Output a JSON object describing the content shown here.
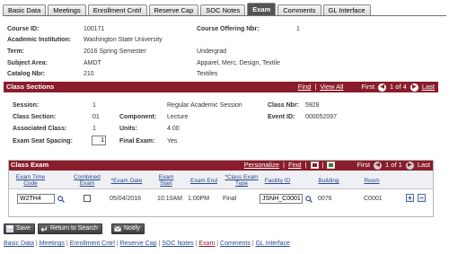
{
  "tabs": [
    {
      "label": "Basic Data",
      "active": false
    },
    {
      "label": "Meetings",
      "active": false
    },
    {
      "label": "Enrollment Cntrl",
      "active": false
    },
    {
      "label": "Reserve Cap",
      "active": false
    },
    {
      "label": "SOC Notes",
      "active": false
    },
    {
      "label": "Exam",
      "active": true
    },
    {
      "label": "Comments",
      "active": false
    },
    {
      "label": "GL Interface",
      "active": false
    }
  ],
  "course": {
    "course_id_label": "Course ID:",
    "course_id": "100171",
    "offering_label": "Course Offering Nbr:",
    "offering": "1",
    "institution_label": "Academic Institution:",
    "institution": "Washington State University",
    "term_label": "Term:",
    "term": "2016 Spring Semester",
    "career": "Undergrad",
    "subject_label": "Subject Area:",
    "subject": "AMDT",
    "subject_desc": "Apparel, Merc, Design, Textile",
    "catalog_label": "Catalog Nbr:",
    "catalog": "210",
    "catalog_desc": "Textiles"
  },
  "class_sections": {
    "title": "Class Sections",
    "find": "Find",
    "view_all": "View All",
    "first": "First",
    "position": "1 of 4",
    "last": "Last",
    "session_label": "Session:",
    "session": "1",
    "session_desc": "Regular Academic Session",
    "class_nbr_label": "Class Nbr:",
    "class_nbr": "5928",
    "class_section_label": "Class Section:",
    "class_section": "01",
    "component_label": "Component:",
    "component": "Lecture",
    "event_id_label": "Event ID:",
    "event_id": "000052097",
    "associated_label": "Associated Class:",
    "associated": "1",
    "units_label": "Units:",
    "units": "4.00",
    "seat_spacing_label": "Exam Seat Spacing:",
    "seat_spacing": "1",
    "final_exam_label": "Final Exam:",
    "final_exam": "Yes"
  },
  "class_exam": {
    "title": "Class Exam",
    "personalize": "Personalize",
    "find": "Find",
    "first": "First",
    "position": "1 of 1",
    "last": "Last",
    "headers": {
      "exam_time_code": "Exam Time Code",
      "combined_exam": "Combined Exam",
      "exam_date": "*Exam Date",
      "exam_start": "Exam Start",
      "exam_end": "Exam End",
      "class_exam_type": "*Class Exam Type",
      "facility_id": "Facility ID",
      "building": "Building",
      "room": "Room"
    },
    "row": {
      "exam_time_code": "W2TH4",
      "combined_exam": false,
      "exam_date": "05/04/2016",
      "exam_start": "10:10AM",
      "exam_end": "1:00PM",
      "class_exam_type": "Final",
      "facility_id": "JSNH_C0001",
      "building": "0076",
      "room": "C0001"
    }
  },
  "buttons": {
    "save": "Save",
    "return_to_search": "Return to Search",
    "notify": "Notify"
  },
  "footer_links": [
    "Basic Data",
    "Meetings",
    "Enrollment Cntrl",
    "Reserve Cap",
    "SOC Notes",
    "Exam",
    "Comments",
    "GL Interface"
  ],
  "colors": {
    "bar": "#8a1d2b",
    "active_tab": "#545454",
    "link": "#2a4a8a"
  }
}
